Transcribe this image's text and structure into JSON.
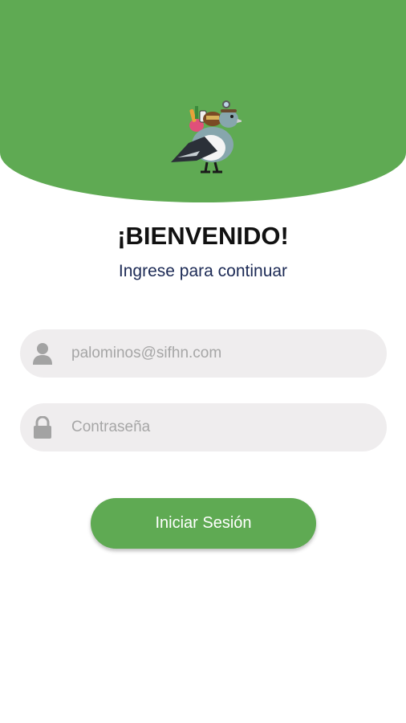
{
  "colors": {
    "brand_green": "#5faa53",
    "field_background": "#efedee",
    "subtitle": "#1c2a55"
  },
  "header": {
    "logo_icon": "pigeon-mascot-logo"
  },
  "welcome": {
    "title": "¡BIENVENIDO!",
    "subtitle": "Ingrese para continuar"
  },
  "form": {
    "email": {
      "icon": "user-icon",
      "placeholder": "palominos@sifhn.com",
      "value": ""
    },
    "password": {
      "icon": "lock-icon",
      "placeholder": "Contraseña",
      "value": ""
    },
    "submit_label": "Iniciar Sesión"
  }
}
